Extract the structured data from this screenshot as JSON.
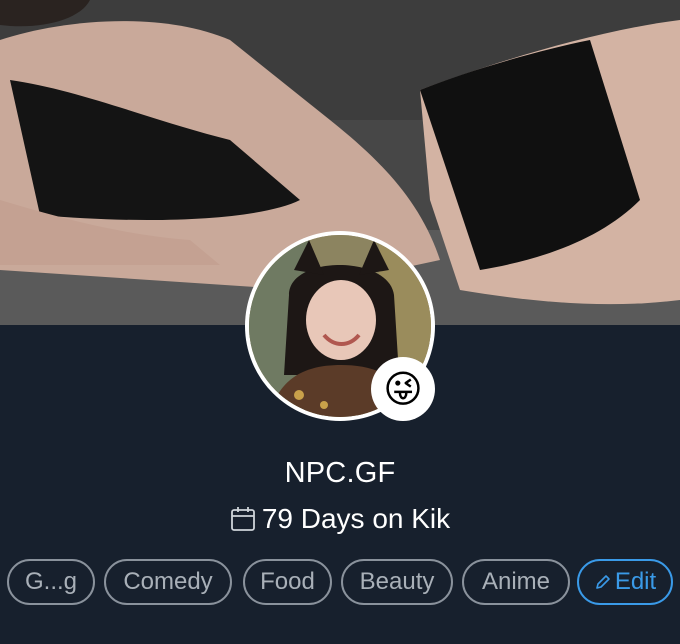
{
  "profile": {
    "display_name": "NPC.GF",
    "days_label": "79 Days on Kik",
    "status_emoji": "😜",
    "cover_image": "cover-photo",
    "avatar_image": "profile-photo"
  },
  "icons": {
    "calendar": "calendar-icon",
    "edit": "pencil-icon"
  },
  "interests": [
    {
      "label": "G...g"
    },
    {
      "label": "Comedy"
    },
    {
      "label": "Food"
    },
    {
      "label": "Beauty"
    },
    {
      "label": "Anime"
    }
  ],
  "edit_label": "Edit",
  "colors": {
    "background": "#17202d",
    "tag_border": "#8a929c",
    "tag_text": "#a9b0b8",
    "accent": "#3a9ae8",
    "text": "#ffffff"
  }
}
